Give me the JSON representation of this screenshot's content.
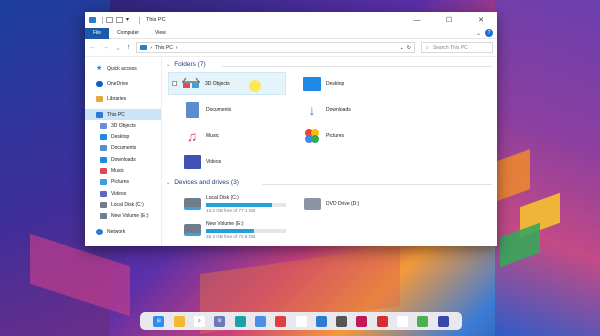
{
  "window": {
    "title": "This PC",
    "ribbon_tabs": [
      "File",
      "Computer",
      "View"
    ],
    "help_label": "?",
    "controls": {
      "minimize": "—",
      "maximize": "☐",
      "close": "✕"
    }
  },
  "address": {
    "back": "←",
    "forward": "→",
    "recent": "⌄",
    "up": "↑",
    "path_label": "This PC",
    "path_sep": "›",
    "dropdown": "⌄",
    "refresh": "↻",
    "search_placeholder": "Search This PC"
  },
  "sidebar": {
    "items": [
      {
        "label": "Quick access",
        "icon": "star-icon",
        "color": "#2a7bd3"
      },
      {
        "label": "OneDrive",
        "icon": "cloud-icon",
        "color": "#0a64c8"
      },
      {
        "label": "Libraries",
        "icon": "libraries-icon",
        "color": "#e2a93b"
      },
      {
        "label": "This PC",
        "icon": "computer-icon",
        "color": "#2a7bd3"
      },
      {
        "label": "3D Objects",
        "icon": "3d-objects-icon",
        "color": "#6a8fd8"
      },
      {
        "label": "Desktop",
        "icon": "desktop-icon",
        "color": "#1e88e5"
      },
      {
        "label": "Documents",
        "icon": "documents-icon",
        "color": "#5a8dcf"
      },
      {
        "label": "Downloads",
        "icon": "downloads-icon",
        "color": "#1f8ae0"
      },
      {
        "label": "Music",
        "icon": "music-icon",
        "color": "#e0465a"
      },
      {
        "label": "Pictures",
        "icon": "pictures-icon",
        "color": "#3e9de0"
      },
      {
        "label": "Videos",
        "icon": "videos-icon",
        "color": "#5c6bc0"
      },
      {
        "label": "Local Disk (C:)",
        "icon": "local-disk-icon",
        "color": "#6f7c8a"
      },
      {
        "label": "New Volume (E:)",
        "icon": "volume-icon",
        "color": "#6f7c8a"
      },
      {
        "label": "Network",
        "icon": "network-icon",
        "color": "#2a7bd3"
      }
    ]
  },
  "folders": {
    "header": "Folders (7)",
    "items": [
      {
        "label": "3D Objects",
        "icon": "3d-glasses-icon"
      },
      {
        "label": "Desktop",
        "icon": "desktop-icon"
      },
      {
        "label": "Documents",
        "icon": "documents-icon"
      },
      {
        "label": "Downloads",
        "icon": "downloads-icon"
      },
      {
        "label": "Music",
        "icon": "music-icon"
      },
      {
        "label": "Pictures",
        "icon": "pictures-icon"
      },
      {
        "label": "Videos",
        "icon": "videos-icon"
      }
    ]
  },
  "drives": {
    "header": "Devices and drives (3)",
    "items": [
      {
        "label": "Local Disk (C:)",
        "free": "14.2 GB free of 77.1 GB",
        "used_fraction": 0.82,
        "icon": "local-disk-icon"
      },
      {
        "label": "DVD Drive (D:)",
        "icon": "dvd-drive-icon"
      },
      {
        "label": "New Volume (E:)",
        "free": "28.3 GB free of 70.9 GB",
        "used_fraction": 0.6,
        "icon": "volume-icon"
      }
    ]
  },
  "taskbar": {
    "icons": [
      "start-icon",
      "files-icon",
      "search-icon",
      "settings-icon",
      "edge-icon",
      "photos-icon",
      "red-app-icon",
      "app-icon",
      "store-icon",
      "camera-icon",
      "media-icon",
      "app2-icon",
      "music-app-icon",
      "app3-icon",
      "app4-icon"
    ]
  },
  "colors": {
    "accent": "#1a5aa8",
    "selected": "#cce4f7",
    "drive_bar": "#26a0da"
  }
}
